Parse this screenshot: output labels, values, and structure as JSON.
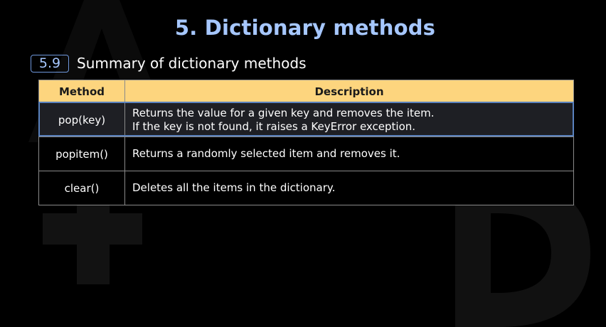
{
  "header": {
    "title": "5. Dictionary methods"
  },
  "section": {
    "number": "5.9",
    "title": "Summary of dictionary methods"
  },
  "table": {
    "columns": [
      "Method",
      "Description"
    ],
    "rows": [
      {
        "method": "pop(key)",
        "description_lines": [
          "Returns the value for a given key and removes the item.",
          "If the key is not found, it raises a KeyError exception."
        ]
      },
      {
        "method": "popitem()",
        "description_lines": [
          "Returns a randomly selected item and removes it."
        ]
      },
      {
        "method": "clear()",
        "description_lines": [
          "Deletes all the items in the dictionary."
        ]
      }
    ]
  },
  "colors": {
    "title": "#a6c7ff",
    "header_bg": "#fdd57e",
    "highlight_border": "#5a82be",
    "background": "#000000"
  }
}
